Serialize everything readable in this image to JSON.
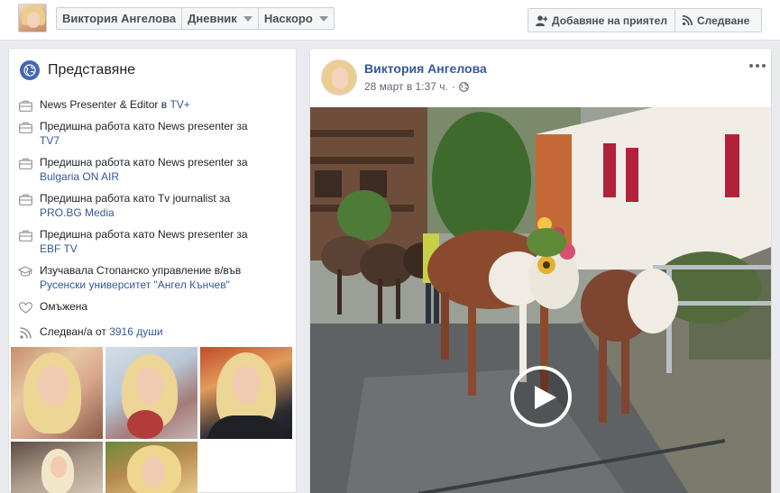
{
  "header": {
    "crumbs": [
      {
        "label": "Виктория Ангелова",
        "dropdown": false
      },
      {
        "label": "Дневник",
        "dropdown": true
      },
      {
        "label": "Наскоро",
        "dropdown": true
      }
    ],
    "add_friend_label": "Добавяне на приятел",
    "follow_label": "Следване"
  },
  "intro": {
    "title": "Представяне",
    "items": [
      {
        "icon": "briefcase-icon",
        "text": "News Presenter & Editor в ",
        "link": "TV+"
      },
      {
        "icon": "briefcase-icon",
        "text": "Предишна работа като News presenter за",
        "link": "TV7"
      },
      {
        "icon": "briefcase-icon",
        "text": "Предишна работа като News presenter за",
        "link": "Bulgaria ON AIR"
      },
      {
        "icon": "briefcase-icon",
        "text": "Предишна работа като Tv journalist за",
        "link": "PRO.BG Media"
      },
      {
        "icon": "briefcase-icon",
        "text": "Предишна работа като News presenter за",
        "link": "EBF TV"
      },
      {
        "icon": "graduation-cap-icon",
        "text": "Изучавала Стопанско управление в/във",
        "link": "Русенски университет \"Ангел Кънчев\""
      },
      {
        "icon": "heart-icon",
        "text": "Омъжена",
        "link": ""
      },
      {
        "icon": "rss-icon",
        "text": "Следван/а от ",
        "link": "3916 души"
      }
    ]
  },
  "post": {
    "author": "Виктория Ангелова",
    "time": "28 март в 1:37 ч.",
    "privacy_icon": "globe-icon"
  },
  "colors": {
    "link": "#365899",
    "page_bg": "#e9ebee",
    "brand": "#4267b2"
  }
}
